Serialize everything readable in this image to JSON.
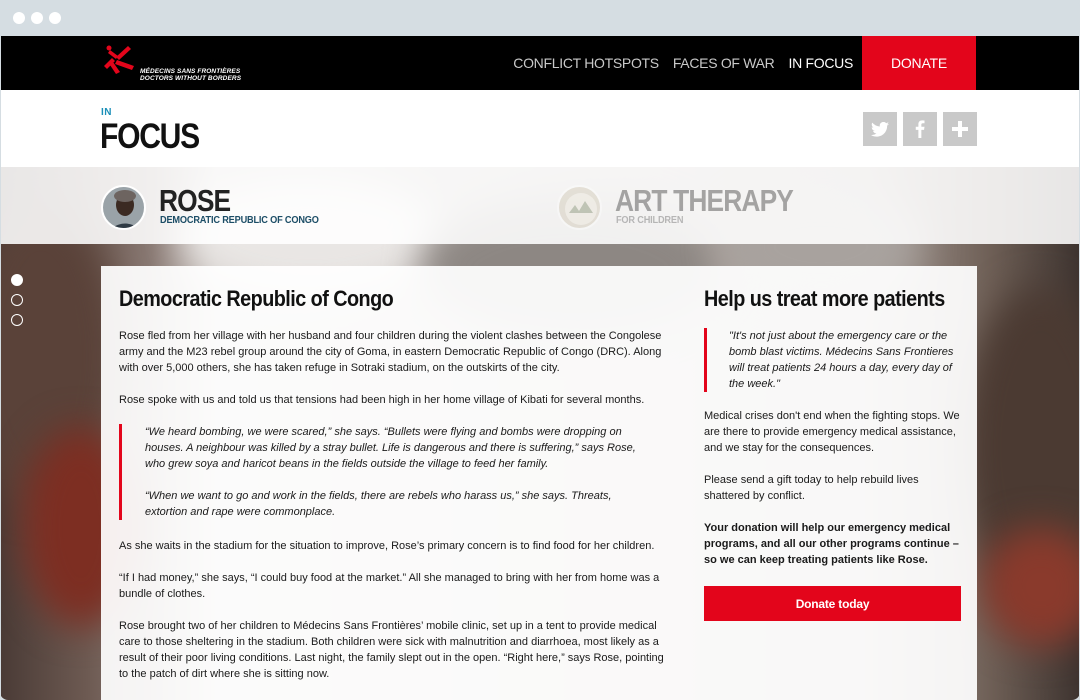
{
  "brand": {
    "logo_line1": "MÉDECINS SANS FRONTIÈRES",
    "logo_line2": "DOCTORS WITHOUT BORDERS",
    "accent": "#e3051b"
  },
  "nav": {
    "links": [
      "CONFLICT HOTSPOTS",
      "FACES OF WAR",
      "IN FOCUS"
    ],
    "active": "IN FOCUS",
    "donate": "DONATE"
  },
  "header": {
    "kicker": "IN",
    "title": "FOCUS",
    "social_icons": [
      "twitter-icon",
      "facebook-icon",
      "plus-icon"
    ]
  },
  "stories": [
    {
      "name": "ROSE",
      "subtitle": "DEMOCRATIC REPUBLIC OF CONGO"
    },
    {
      "name": "ART THERAPY",
      "subtitle": "FOR CHILDREN"
    }
  ],
  "pager": {
    "count": 3,
    "active": 1
  },
  "main": {
    "heading": "Democratic Republic of Congo",
    "p1": "Rose fled from her village with her husband and four children during the violent clashes between the Congolese army and the M23 rebel group around the city of Goma, in eastern Democratic Republic of Congo (DRC). Along with over 5,000 others, she has taken refuge in Sotraki stadium, on the outskirts of the city.",
    "p2": "Rose spoke with us and told us that tensions had been high in her home village of Kibati for several months.",
    "quote1": "“We heard bombing, we were scared,” she says. “Bullets were flying and bombs were dropping on houses. A neighbour was killed by a stray bullet. Life is dangerous and there is suffering,” says Rose, who grew soya and haricot beans in the fields outside the village to feed her family.",
    "quote2": "“When we want to go and work in the fields, there are rebels who harass us,” she says. Threats, extortion and rape were commonplace.",
    "p3": "As she waits in the stadium for the situation to improve, Rose’s primary concern is to find food for her children.",
    "p4": "“If I had money,” she says, “I could buy food at the market.” All she managed to bring with her from home was a bundle of clothes.",
    "p5": "Rose brought two of her children to Médecins Sans Frontières’ mobile clinic, set up in a tent to provide medical care to those sheltering in the stadium. Both children were sick with malnutrition and diarrhoea, most likely as a result of their poor living conditions. Last night, the family slept out in the open. “Right here,” says Rose, pointing to the patch of dirt where she is sitting now."
  },
  "sidebar": {
    "heading": "Help us treat more patients",
    "quote": "\"It's not just about the emergency care or the bomb blast victims. Médecins Sans Frontieres will treat patients 24 hours a day, every day of the week.\"",
    "p1": "Medical crises don't end when the fighting stops. We are there to provide emergency medical assistance, and we stay for the consequences.",
    "p2": "Please send a gift today to help rebuild lives shattered by conflict.",
    "p3": "Your donation will help our emergency medical programs, and all our other programs continue – so we can keep treating patients like Rose.",
    "button": "Donate today"
  }
}
